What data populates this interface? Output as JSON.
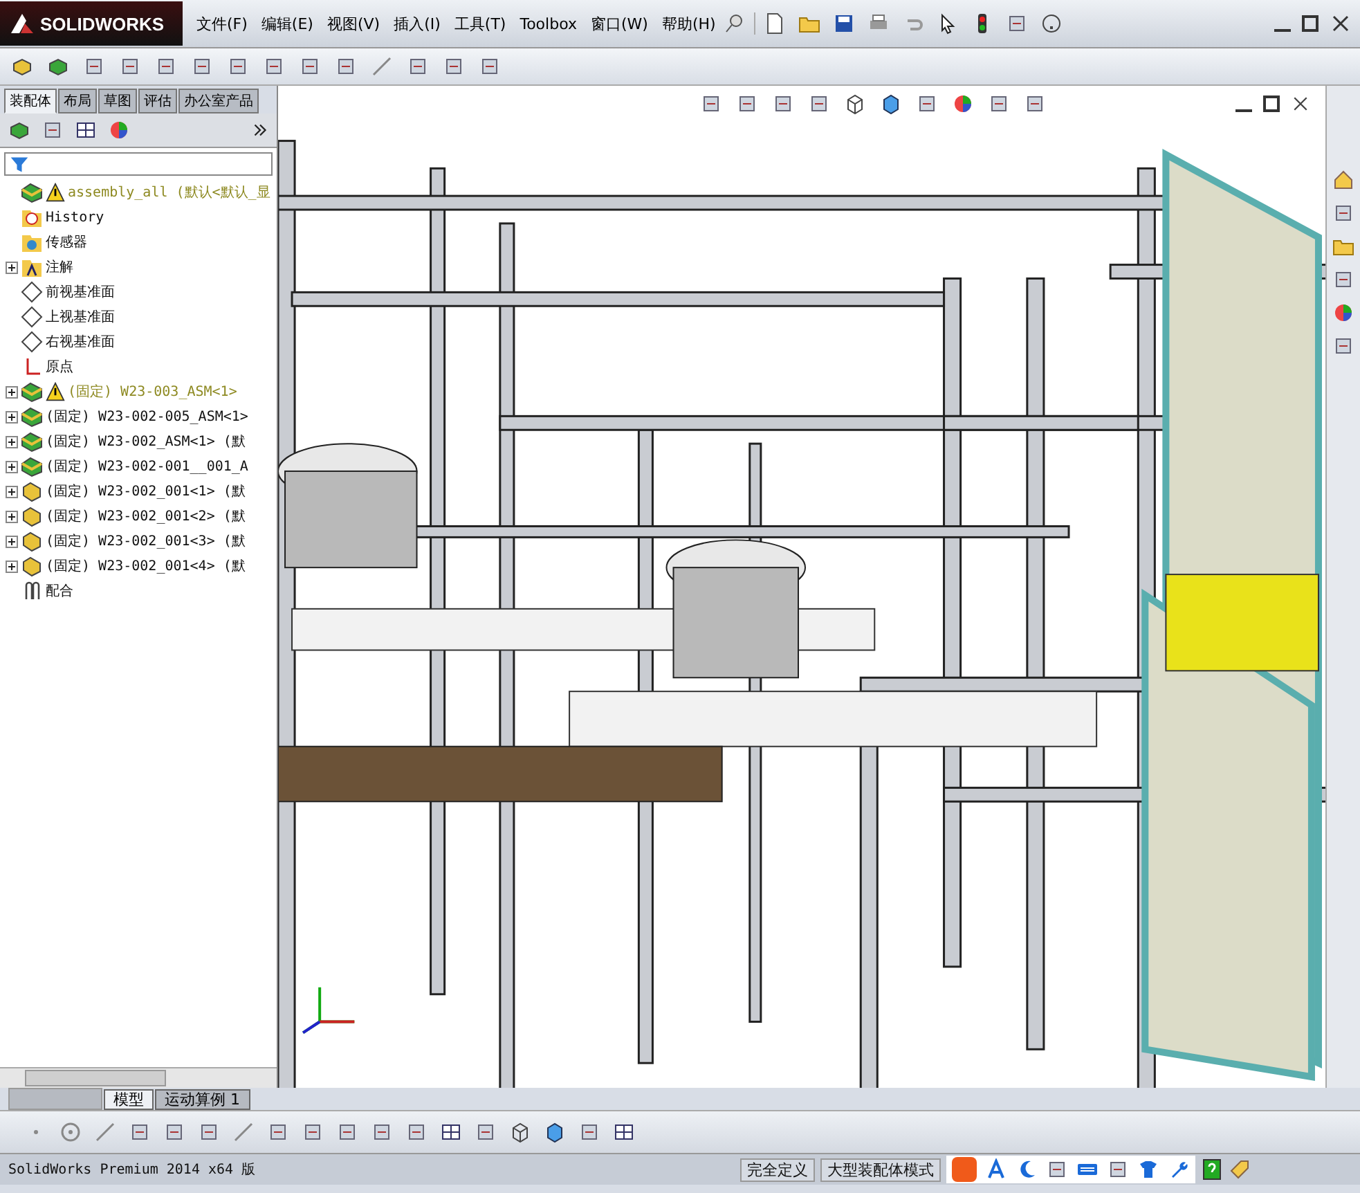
{
  "app": {
    "logo": "SOLIDWORKS"
  },
  "menu": [
    "文件(F)",
    "编辑(E)",
    "视图(V)",
    "插入(I)",
    "工具(T)",
    "Toolbox",
    "窗口(W)",
    "帮助(H)"
  ],
  "command_tabs": [
    {
      "label": "装配体",
      "selected": true
    },
    {
      "label": "布局",
      "selected": false
    },
    {
      "label": "草图",
      "selected": false
    },
    {
      "label": "评估",
      "selected": false
    },
    {
      "label": "办公室产品",
      "selected": false
    }
  ],
  "feature_tree": {
    "root": {
      "label": "assembly_all",
      "config": "(默认<默认_显",
      "warning": true,
      "children": [
        {
          "kind": "history",
          "label": "History"
        },
        {
          "kind": "sensor",
          "label": "传感器"
        },
        {
          "kind": "annotation",
          "label": "注解",
          "expanded": false
        },
        {
          "kind": "plane",
          "label": "前视基准面"
        },
        {
          "kind": "plane",
          "label": "上视基准面"
        },
        {
          "kind": "plane",
          "label": "右视基准面"
        },
        {
          "kind": "origin",
          "label": "原点"
        },
        {
          "kind": "assembly",
          "label": "(固定) W23-003_ASM<1>",
          "expanded": false,
          "warning": true
        },
        {
          "kind": "assembly",
          "label": "(固定) W23-002-005_ASM<1>",
          "expanded": false,
          "warning": false
        },
        {
          "kind": "assembly",
          "label": "(固定) W23-002_ASM<1> (默",
          "expanded": false,
          "warning": false
        },
        {
          "kind": "assembly",
          "label": "(固定) W23-002-001__001_A",
          "expanded": false,
          "warning": false
        },
        {
          "kind": "part",
          "label": "(固定) W23-002_001<1> (默",
          "expanded": false,
          "warning": false
        },
        {
          "kind": "part",
          "label": "(固定) W23-002_001<2> (默",
          "expanded": false,
          "warning": false
        },
        {
          "kind": "part",
          "label": "(固定) W23-002_001<3> (默",
          "expanded": false,
          "warning": false
        },
        {
          "kind": "part",
          "label": "(固定) W23-002_001<4> (默",
          "expanded": false,
          "warning": false
        },
        {
          "kind": "mates",
          "label": "配合"
        }
      ]
    }
  },
  "bottom_tabs": [
    {
      "label": "模型",
      "selected": true
    },
    {
      "label": "运动算例 1",
      "selected": false
    }
  ],
  "status_bar": {
    "product": "SolidWorks Premium 2014 x64 版",
    "fields": [
      "完全定义",
      "大型装配体模式"
    ]
  }
}
